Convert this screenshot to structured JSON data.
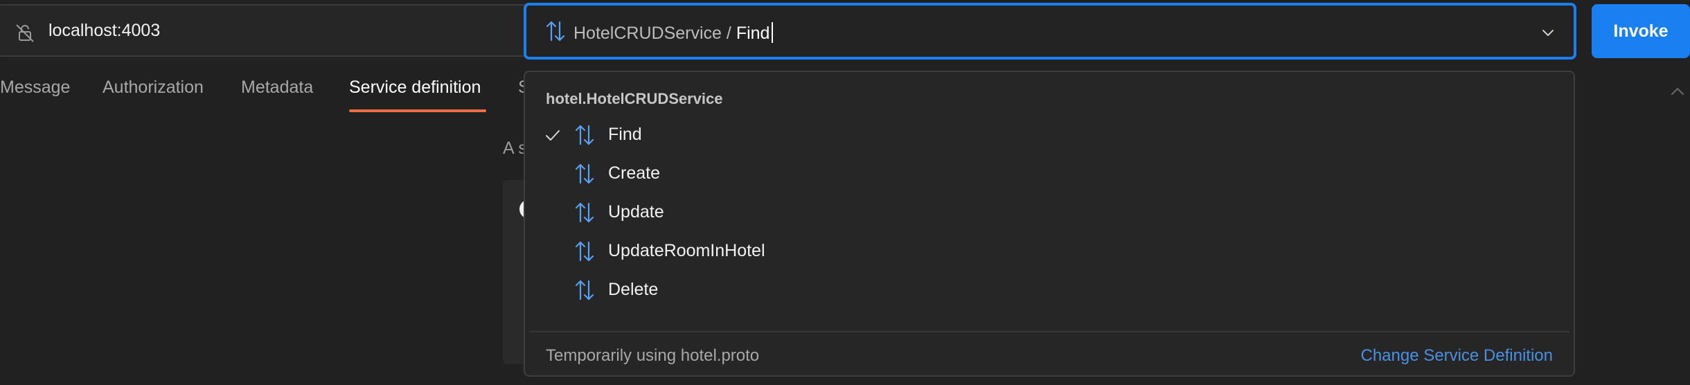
{
  "address": {
    "url": "localhost:4003",
    "icon": "lock-off-icon"
  },
  "method_selector": {
    "service": "HotelCRUDService",
    "separator": "/",
    "method": "Find",
    "icon": "bidirectional-stream-icon",
    "dropdown_icon": "chevron-down-icon"
  },
  "invoke_label": "Invoke",
  "tabs": [
    {
      "label": "Message",
      "active": false
    },
    {
      "label": "Authorization",
      "active": false
    },
    {
      "label": "Metadata",
      "active": false
    },
    {
      "label": "Service definition",
      "active": true
    }
  ],
  "tab_clipped": "S",
  "background_text": "A s",
  "dropdown": {
    "group_title": "hotel.HotelCRUDService",
    "items": [
      {
        "label": "Find",
        "selected": true
      },
      {
        "label": "Create",
        "selected": false
      },
      {
        "label": "Update",
        "selected": false
      },
      {
        "label": "UpdateRoomInHotel",
        "selected": false
      },
      {
        "label": "Delete",
        "selected": false
      }
    ],
    "footer_text": "Temporarily using hotel.proto",
    "footer_link": "Change Service Definition"
  },
  "colors": {
    "accent": "#1a7ff0",
    "active_tab_underline": "#ef6c44",
    "link": "#4a90e2",
    "icon": "#5aa0f2"
  }
}
